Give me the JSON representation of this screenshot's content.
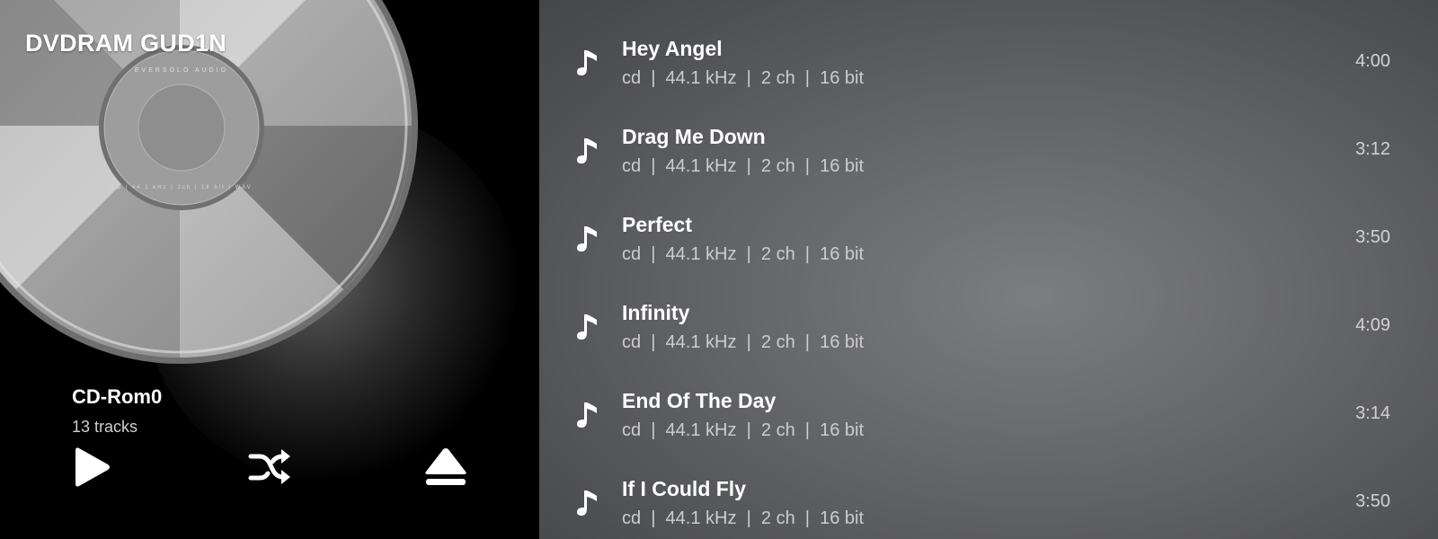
{
  "device": {
    "name": "DVDRAM GUD1N"
  },
  "album": {
    "title": "CD-Rom0",
    "subtitle": "13 tracks"
  },
  "disc": {
    "ring_text_top": "EVERSOLO AUDIO",
    "ring_text_bottom": "CD | 44.1 kHz | 2ch | 16 bit | WAV"
  },
  "controls": {
    "play_icon": "play-icon",
    "shuffle_icon": "shuffle-icon",
    "eject_icon": "eject-icon"
  },
  "tracks": [
    {
      "title": "Hey Angel",
      "meta": "cd  |  44.1 kHz  |  2 ch  |  16 bit",
      "duration": "4:00"
    },
    {
      "title": "Drag Me Down",
      "meta": "cd  |  44.1 kHz  |  2 ch  |  16 bit",
      "duration": "3:12"
    },
    {
      "title": "Perfect",
      "meta": "cd  |  44.1 kHz  |  2 ch  |  16 bit",
      "duration": "3:50"
    },
    {
      "title": "Infinity",
      "meta": "cd  |  44.1 kHz  |  2 ch  |  16 bit",
      "duration": "4:09"
    },
    {
      "title": "End Of The Day",
      "meta": "cd  |  44.1 kHz  |  2 ch  |  16 bit",
      "duration": "3:14"
    },
    {
      "title": "If I Could Fly",
      "meta": "cd  |  44.1 kHz  |  2 ch  |  16 bit",
      "duration": "3:50"
    }
  ],
  "colors": {
    "accent": "#ffffff",
    "meta_text": "#cdcdcf",
    "list_bg": "#66676b"
  }
}
